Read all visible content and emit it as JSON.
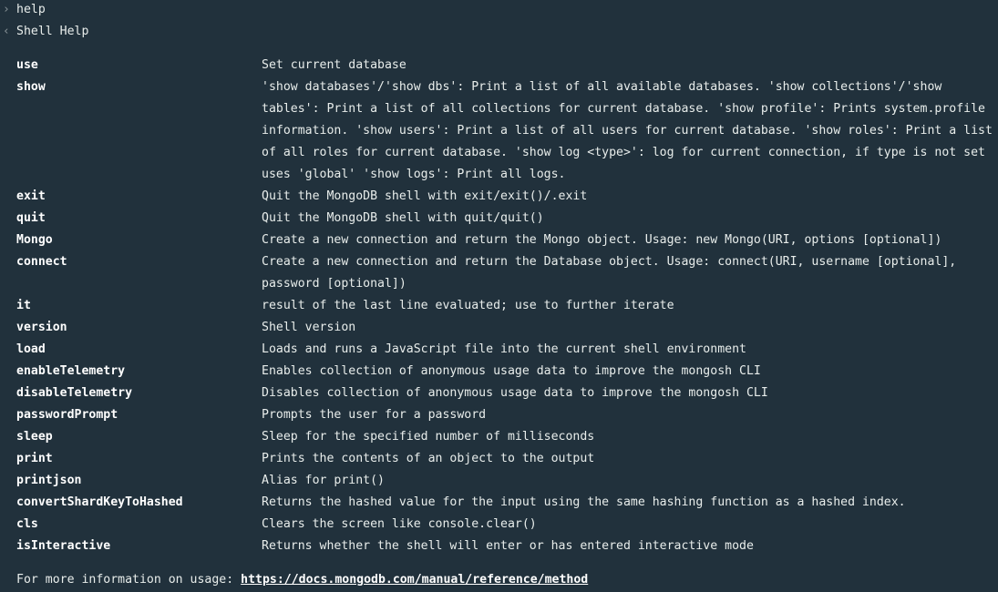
{
  "input": {
    "command": "help"
  },
  "output": {
    "heading": "Shell Help",
    "commands": [
      {
        "name": "use",
        "desc": "Set current database"
      },
      {
        "name": "show",
        "desc": "'show databases'/'show dbs': Print a list of all available databases. 'show collections'/'show tables': Print a list of all collections for current database. 'show profile': Prints system.profile information. 'show users': Print a list of all users for current database. 'show roles': Print a list of all roles for current database. 'show log <type>': log for current connection, if type is not set uses 'global' 'show logs': Print all logs."
      },
      {
        "name": "exit",
        "desc": "Quit the MongoDB shell with exit/exit()/.exit"
      },
      {
        "name": "quit",
        "desc": "Quit the MongoDB shell with quit/quit()"
      },
      {
        "name": "Mongo",
        "desc": "Create a new connection and return the Mongo object. Usage: new Mongo(URI, options [optional])"
      },
      {
        "name": "connect",
        "desc": "Create a new connection and return the Database object. Usage: connect(URI, username [optional], password [optional])"
      },
      {
        "name": "it",
        "desc": "result of the last line evaluated; use to further iterate"
      },
      {
        "name": "version",
        "desc": "Shell version"
      },
      {
        "name": "load",
        "desc": "Loads and runs a JavaScript file into the current shell environment"
      },
      {
        "name": "enableTelemetry",
        "desc": "Enables collection of anonymous usage data to improve the mongosh CLI"
      },
      {
        "name": "disableTelemetry",
        "desc": "Disables collection of anonymous usage data to improve the mongosh CLI"
      },
      {
        "name": "passwordPrompt",
        "desc": "Prompts the user for a password"
      },
      {
        "name": "sleep",
        "desc": "Sleep for the specified number of milliseconds"
      },
      {
        "name": "print",
        "desc": "Prints the contents of an object to the output"
      },
      {
        "name": "printjson",
        "desc": "Alias for print()"
      },
      {
        "name": "convertShardKeyToHashed",
        "desc": "Returns the hashed value for the input using the same hashing function as a hashed index."
      },
      {
        "name": "cls",
        "desc": "Clears the screen like console.clear()"
      },
      {
        "name": "isInteractive",
        "desc": "Returns whether the shell will enter or has entered interactive mode"
      }
    ],
    "footer_text": "For more information on usage: ",
    "footer_link": "https://docs.mongodb.com/manual/reference/method"
  },
  "icons": {
    "input_chevron": "chevron-right-icon",
    "output_chevron": "chevron-left-icon"
  },
  "colors": {
    "background": "#21313c",
    "text": "#e8edeb",
    "chevron": "#889397"
  }
}
